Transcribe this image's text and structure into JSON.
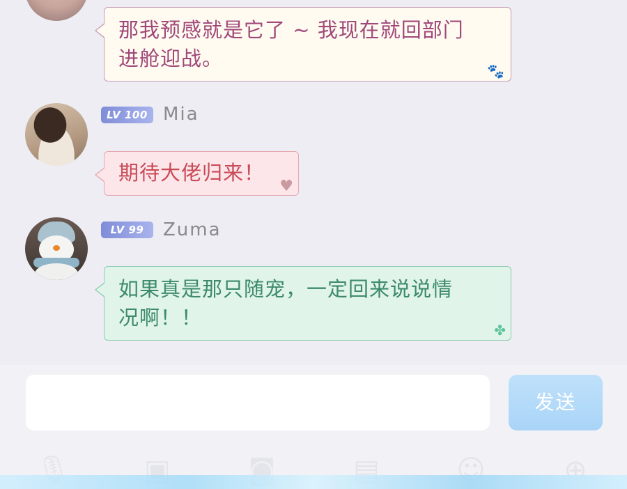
{
  "messages": [
    {
      "lines": [
        "那我预感就是它了 ~ 我现在就回部门",
        "进舱迎战。"
      ],
      "theme": "paw",
      "deco_icon": "paw-icon"
    },
    {
      "user": {
        "name": "Mia",
        "level": "LV 100"
      },
      "lines": [
        "期待大佬归来！"
      ],
      "theme": "heart",
      "deco_icon": "heart-icon"
    },
    {
      "user": {
        "name": "Zuma",
        "level": "LV 99"
      },
      "lines": [
        "如果真是那只随宠，一定回来说说情",
        "况啊！！"
      ],
      "theme": "clover",
      "deco_icon": "clover-icon"
    }
  ],
  "composer": {
    "input_value": "",
    "send_label": "发送"
  },
  "toolbar": {
    "icons": [
      "microphone-icon",
      "image-icon",
      "camera-icon",
      "photo-icon",
      "emoji-icon",
      "plus-icon"
    ]
  },
  "colors": {
    "paw_bubble_bg": "#fffbf0",
    "paw_bubble_text": "#a0487a",
    "heart_bubble_bg": "#fde6e9",
    "heart_bubble_text": "#c84b57",
    "clover_bubble_bg": "#e0f4ea",
    "clover_bubble_text": "#3d8a6a",
    "level_badge": "#8e9be0",
    "send_button": "#b5dbf9"
  }
}
